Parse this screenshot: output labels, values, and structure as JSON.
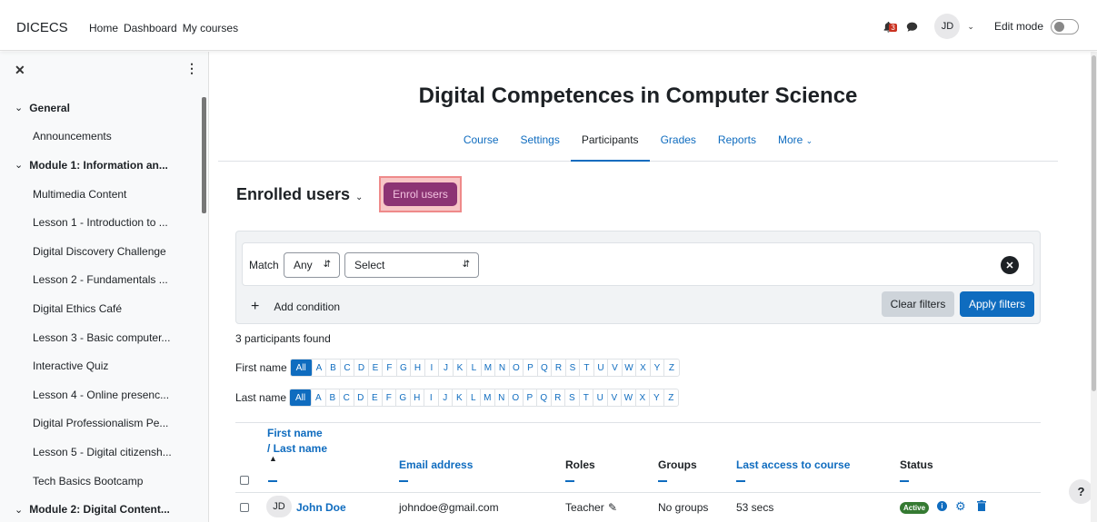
{
  "navbar": {
    "brand": "DICECS",
    "links": [
      "Home",
      "Dashboard",
      "My courses"
    ],
    "notification_count": "3",
    "user_initials": "JD",
    "edit_mode_label": "Edit mode",
    "edit_mode_on": false
  },
  "drawer": {
    "items": [
      {
        "label": "General",
        "section": true
      },
      {
        "label": "Announcements",
        "section": false
      },
      {
        "label": "Module 1: Information an...",
        "section": true
      },
      {
        "label": "Multimedia Content",
        "section": false
      },
      {
        "label": "Lesson 1 - Introduction to ...",
        "section": false
      },
      {
        "label": "Digital Discovery Challenge",
        "section": false
      },
      {
        "label": "Lesson 2 - Fundamentals ...",
        "section": false
      },
      {
        "label": "Digital Ethics Café",
        "section": false
      },
      {
        "label": "Lesson 3 - Basic computer...",
        "section": false
      },
      {
        "label": "Interactive Quiz",
        "section": false
      },
      {
        "label": "Lesson 4 - Online presenc...",
        "section": false
      },
      {
        "label": "Digital Professionalism Pe...",
        "section": false
      },
      {
        "label": "Lesson 5 - Digital citizensh...",
        "section": false
      },
      {
        "label": "Tech Basics Bootcamp",
        "section": false
      },
      {
        "label": "Module 2: Digital Content...",
        "section": true
      }
    ]
  },
  "course": {
    "title": "Digital Competences in Computer Science",
    "tabs": [
      "Course",
      "Settings",
      "Participants",
      "Grades",
      "Reports",
      "More"
    ],
    "active_tab": "Participants"
  },
  "participants": {
    "heading": "Enrolled users",
    "enrol_button": "Enrol users",
    "filter": {
      "match_label": "Match",
      "match_value": "Any",
      "select_value": "Select",
      "add_condition": "Add condition",
      "clear_filters": "Clear filters",
      "apply_filters": "Apply filters"
    },
    "found_text": "3 participants found",
    "firstname_label": "First name",
    "lastname_label": "Last name",
    "alpha_all": "All",
    "letters": [
      "A",
      "B",
      "C",
      "D",
      "E",
      "F",
      "G",
      "H",
      "I",
      "J",
      "K",
      "L",
      "M",
      "N",
      "O",
      "P",
      "Q",
      "R",
      "S",
      "T",
      "U",
      "V",
      "W",
      "X",
      "Y",
      "Z"
    ],
    "columns": {
      "first_name": "First name",
      "last_name": "/ Last name",
      "email": "Email address",
      "roles": "Roles",
      "groups": "Groups",
      "last_access": "Last access to course",
      "status": "Status"
    },
    "rows": [
      {
        "initials": "JD",
        "name": "John Doe",
        "email": "johndoe@gmail.com",
        "role": "Teacher",
        "groups": "No groups",
        "last_access": "53 secs",
        "status": "Active"
      }
    ]
  },
  "icons": {
    "notifications": "bell-icon",
    "messages": "chat-icon",
    "close_drawer": "close-icon",
    "drawer_menu": "kebab-icon",
    "edit_role": "pencil-icon",
    "status_info": "info-icon",
    "status_settings": "gear-icon",
    "unenrol": "trash-icon",
    "help": "question-icon"
  },
  "colors": {
    "primary": "#0f6cbf",
    "enrol_button": "#8c3474",
    "active_badge": "#357a32",
    "highlight_border": "#ef8a8a"
  }
}
